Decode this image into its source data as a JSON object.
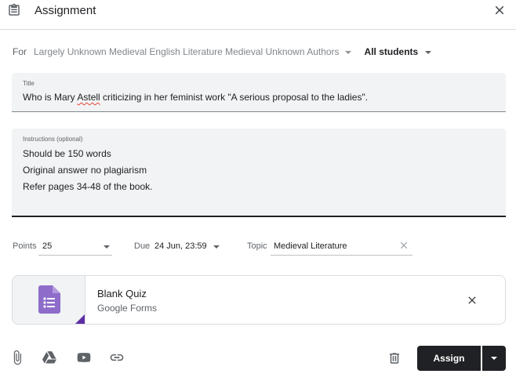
{
  "header": {
    "title": "Assignment",
    "icon": "assignment-icon",
    "close_icon": "close-icon"
  },
  "assign_to": {
    "for_label": "For",
    "class_name": "Largely Unknown Medieval English Literature Medieval Unknown Authors",
    "students": "All students"
  },
  "title_field": {
    "label": "Title",
    "value_before": "Who is Mary ",
    "value_misspelled": "Astell",
    "value_after": " criticizing in her feminist work \"A serious proposal to the ladies\"."
  },
  "instructions_field": {
    "label": "Instructions (optional)",
    "lines": [
      "Should be 150 words",
      "Original answer no plagiarism",
      "Refer pages 34-48 of the book."
    ]
  },
  "meta": {
    "points_label": "Points",
    "points_value": "25",
    "due_label": "Due",
    "due_value": "24 Jun, 23:59",
    "topic_label": "Topic",
    "topic_value": "Medieval Literature"
  },
  "attachment": {
    "name": "Blank Quiz",
    "type": "Google Forms",
    "icon": "google-forms-icon",
    "accent_color": "#8e6cc9"
  },
  "toolbar": {
    "icons": [
      "paperclip-icon",
      "google-drive-icon",
      "youtube-icon",
      "link-icon",
      "trash-icon"
    ]
  },
  "actions": {
    "assign_label": "Assign",
    "button_color": "#202124"
  }
}
